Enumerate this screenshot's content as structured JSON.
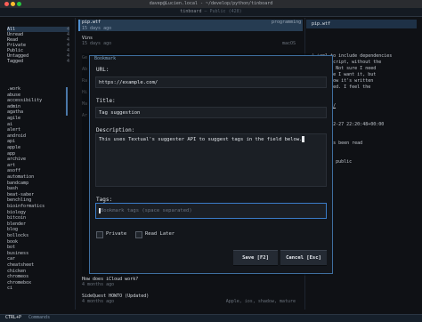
{
  "window": {
    "title": "davep@Lucien.local - ~/develop/python/tinboard"
  },
  "app_header": {
    "name": "tinboard",
    "sep": " — ",
    "subtitle": "Public (428)"
  },
  "filters": [
    {
      "label": "All",
      "count": "4"
    },
    {
      "label": "Unread",
      "count": "4"
    },
    {
      "label": "Read",
      "count": "4"
    },
    {
      "label": "Private",
      "count": "4"
    },
    {
      "label": "Public",
      "count": "4"
    },
    {
      "label": "Untagged",
      "count": "4"
    },
    {
      "label": "Tagged",
      "count": "4"
    }
  ],
  "tags": [
    ".work",
    "abuse",
    "accessibility",
    "admin",
    "agatha",
    "agile",
    "ai",
    "alert",
    "android",
    "api",
    "apple",
    "app",
    "archive",
    "art",
    "asoff",
    "automation",
    "bandcamp",
    "bash",
    "beat-saber",
    "benchling",
    "bioinformatics",
    "biology",
    "bitcoin",
    "blender",
    "blog",
    "bollocks",
    "book",
    "bot",
    "business",
    "car",
    "cheatsheet",
    "chicken",
    "chromeos",
    "chromebox",
    "ci"
  ],
  "list": {
    "selected": {
      "title": "pip.wtf",
      "date": "15 days ago",
      "tags": "programming"
    },
    "items": [
      {
        "title": "Vins",
        "date": "15 days ago",
        "tags": "macOS"
      },
      {
        "title": "How does iCloud work?",
        "date": "4 months ago",
        "tags": ""
      },
      {
        "title": "SideQuest HOWTO (Updated)",
        "date": "4 months ago",
        "tags": "Apple, ios, shadow, mature"
      }
    ],
    "partial": [
      "Ge",
      "Ab",
      "Ra",
      "Hi",
      "Ma",
      "Ar"
    ]
  },
  "details": {
    "header": "pip.wtf",
    "lines": [
      "A tool to include dependencies",
      "Python script, without the",
      "ng faff. Not sure I need",
      "even sure I want it, but",
      "I love how it's written",
      "introduced.  I feel the",
      "e.",
      "",
      "/pip.wtf/",
      "",
      "",
      "- 2023-12-27 22:20:48+00:00",
      "",
      "",
      "kmark has been read",
      "",
      "",
      "kmark is public",
      "",
      "",
      "eming"
    ]
  },
  "dialog": {
    "title": "Bookmark",
    "url_label": "URL:",
    "url_value": "https://example.com/",
    "title_label": "Title:",
    "title_value": "Tag suggestion",
    "desc_label": "Description:",
    "desc_value": "This uses Textual's suggester API to suggest tags in the field below.",
    "tags_label": "Tags:",
    "tags_placeholder": "Bookmark tags (space separated)",
    "private_label": "Private",
    "read_later_label": "Read Later",
    "save_label": "Save [F2]",
    "cancel_label": "Cancel [Esc]"
  },
  "footer": {
    "key": "CTRL+P",
    "label": "Commands"
  },
  "colors": {
    "accent": "#3a7bc8",
    "selected": "#263c52"
  }
}
